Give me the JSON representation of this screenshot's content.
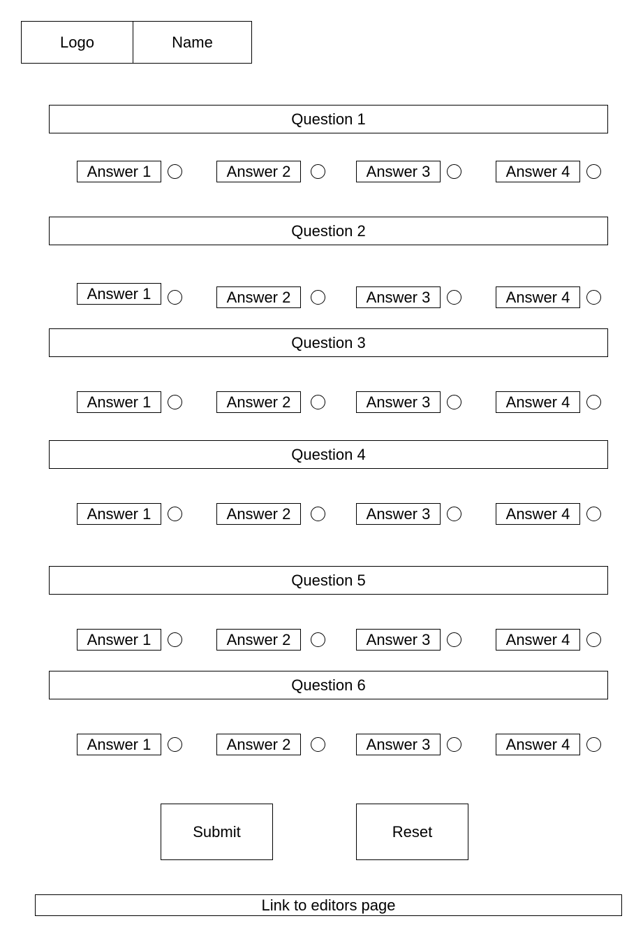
{
  "header": {
    "logo": "Logo",
    "name": "Name"
  },
  "questions": [
    {
      "label": "Question 1",
      "answers": [
        "Answer 1",
        "Answer 2",
        "Answer 3",
        "Answer 4"
      ]
    },
    {
      "label": "Question 2",
      "answers": [
        "Answer 1",
        "Answer 2",
        "Answer 3",
        "Answer 4"
      ]
    },
    {
      "label": "Question 3",
      "answers": [
        "Answer 1",
        "Answer 2",
        "Answer 3",
        "Answer 4"
      ]
    },
    {
      "label": "Question 4",
      "answers": [
        "Answer 1",
        "Answer 2",
        "Answer 3",
        "Answer 4"
      ]
    },
    {
      "label": "Question 5",
      "answers": [
        "Answer 1",
        "Answer 2",
        "Answer 3",
        "Answer 4"
      ]
    },
    {
      "label": "Question 6",
      "answers": [
        "Answer 1",
        "Answer 2",
        "Answer 3",
        "Answer 4"
      ]
    }
  ],
  "actions": {
    "submit_label": "Submit",
    "reset_label": "Reset"
  },
  "footer": {
    "editors_link": "Link to editors page"
  }
}
